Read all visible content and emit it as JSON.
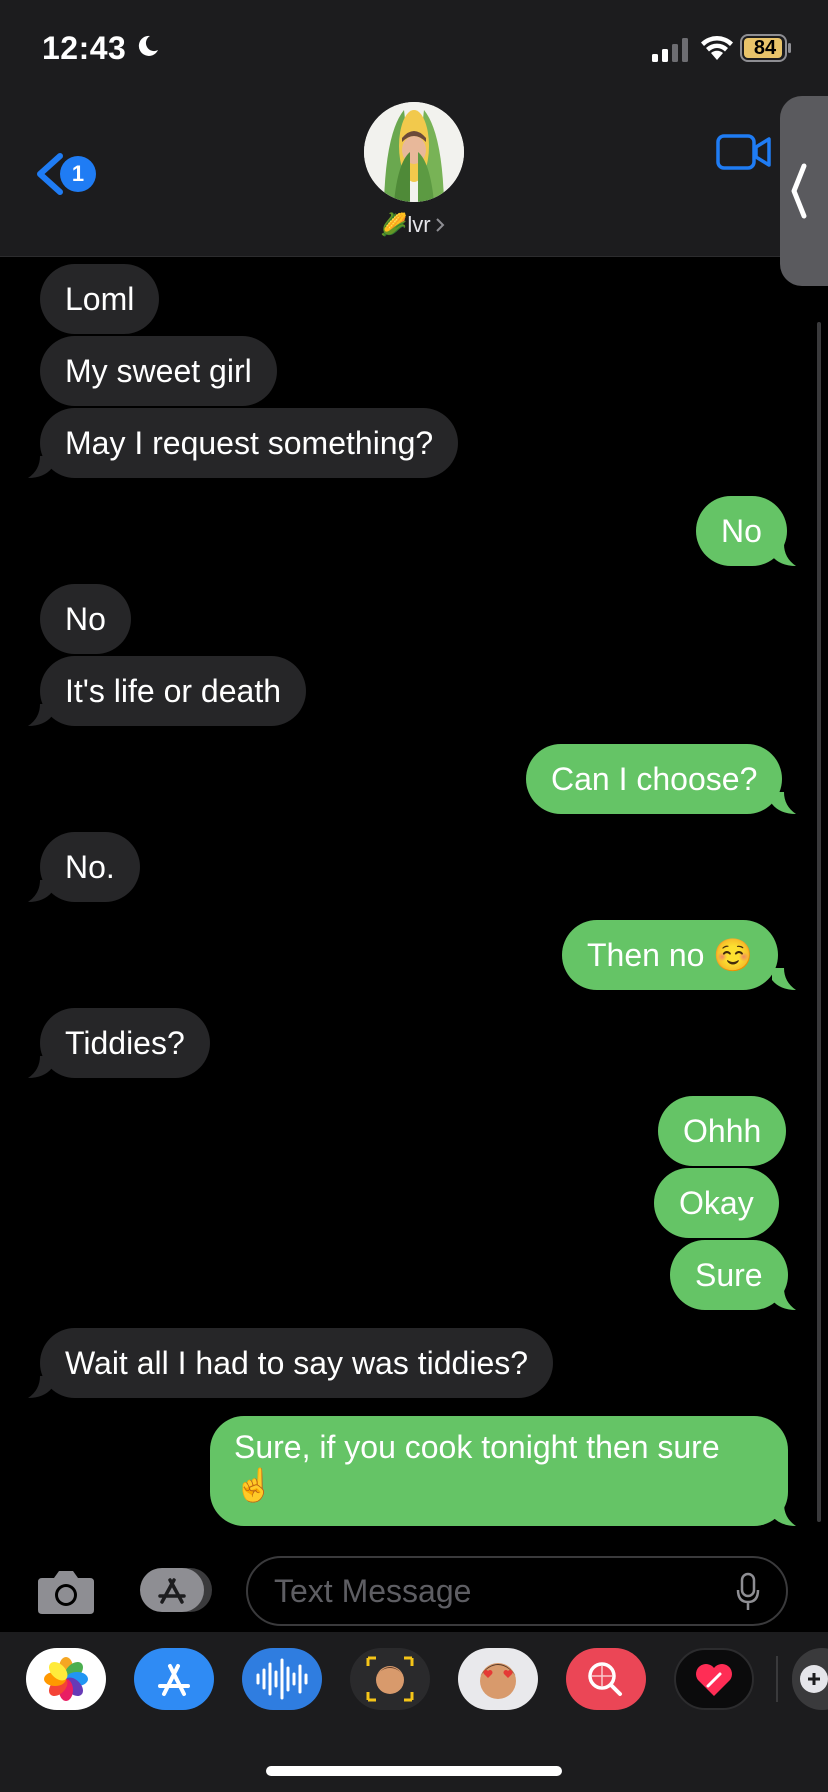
{
  "status": {
    "time": "12:43",
    "battery": "84"
  },
  "header": {
    "unread_count": "1",
    "contact_name": "🌽lvr"
  },
  "messages": [
    {
      "text": "Loml",
      "from": "them"
    },
    {
      "text": "My sweet girl",
      "from": "them"
    },
    {
      "text": "May I request something?",
      "from": "them"
    },
    {
      "text": "No",
      "from": "me"
    },
    {
      "text": "No",
      "from": "them"
    },
    {
      "text": "It's life or death",
      "from": "them"
    },
    {
      "text": "Can I choose?",
      "from": "me"
    },
    {
      "text": "No.",
      "from": "them"
    },
    {
      "text": "Then no ☺️",
      "from": "me"
    },
    {
      "text": "Tiddies?",
      "from": "them"
    },
    {
      "text": "Ohhh",
      "from": "me"
    },
    {
      "text": "Okay",
      "from": "me"
    },
    {
      "text": "Sure",
      "from": "me"
    },
    {
      "text": "Wait all I had to say was tiddies?",
      "from": "them"
    },
    {
      "text": "Sure, if you cook tonight then sure ☝️",
      "from": "me"
    }
  ],
  "composer": {
    "placeholder": "Text Message"
  },
  "app_drawer": [
    {
      "icon": "photos-icon"
    },
    {
      "icon": "app-store-icon"
    },
    {
      "icon": "audio-message-icon"
    },
    {
      "icon": "memoji-camera-icon"
    },
    {
      "icon": "memoji-stickers-icon"
    },
    {
      "icon": "image-search-icon"
    },
    {
      "icon": "digital-touch-icon"
    },
    {
      "icon": "game-icon"
    }
  ],
  "colors": {
    "sent_bubble": "#65c466",
    "received_bubble": "#262628",
    "accent": "#1f7cf4"
  }
}
